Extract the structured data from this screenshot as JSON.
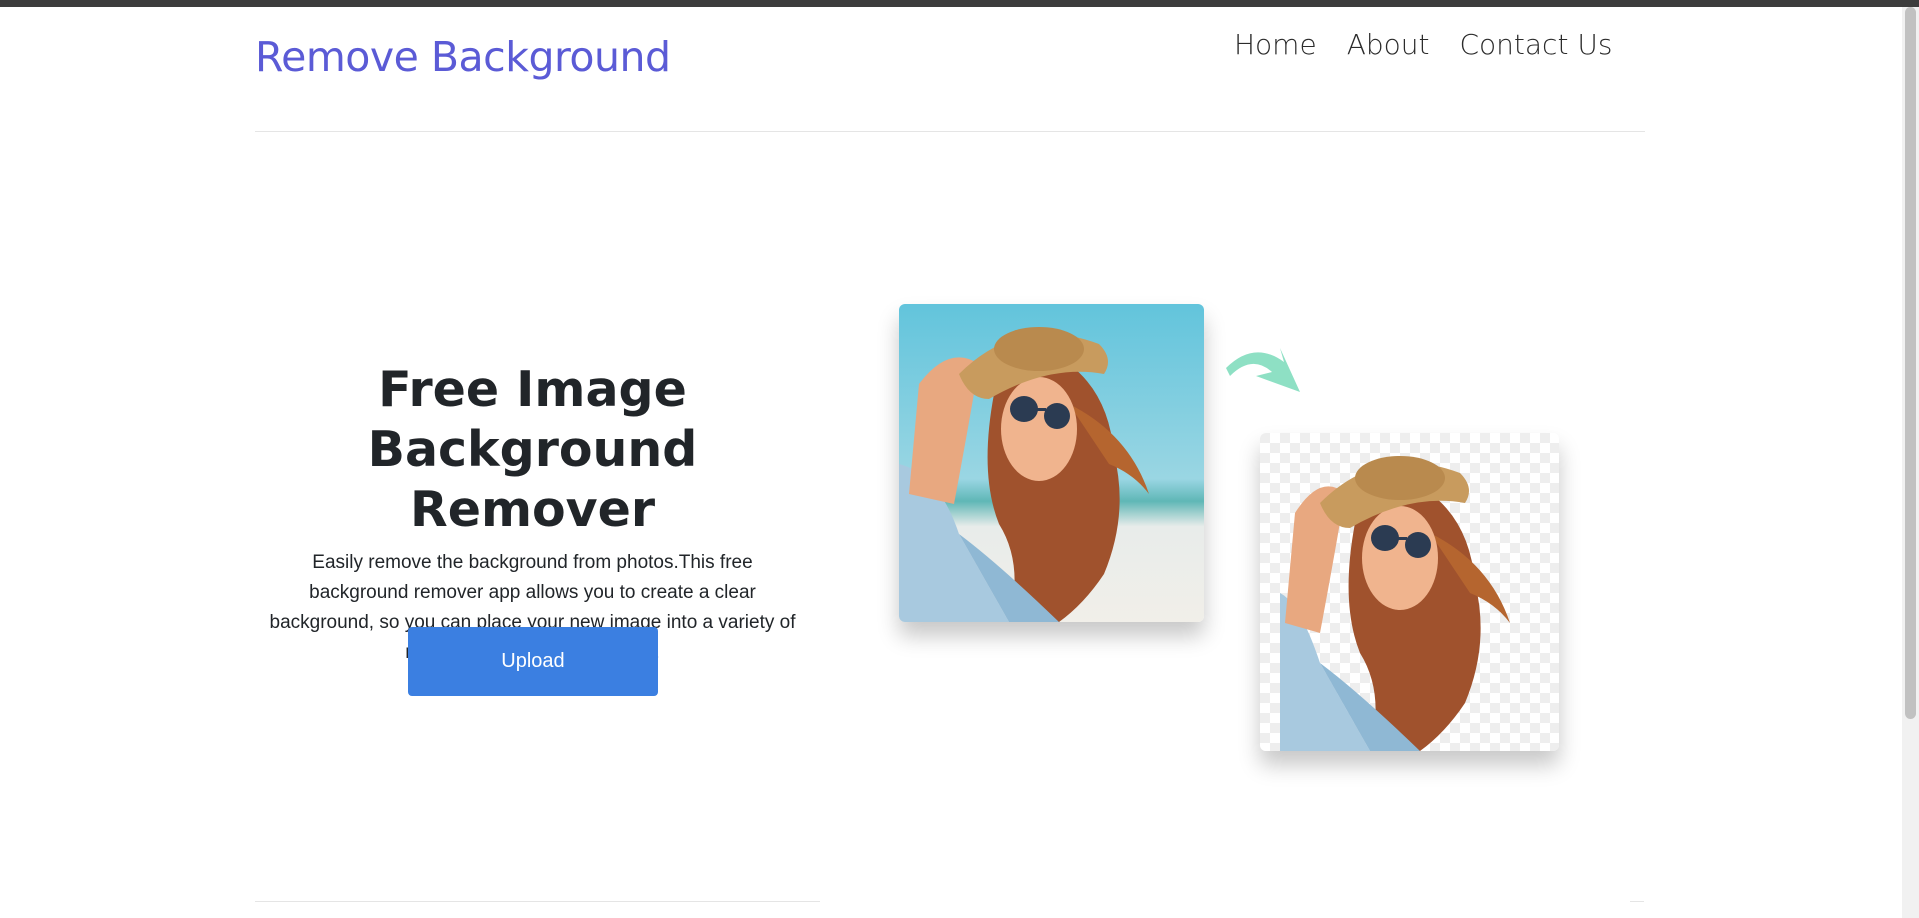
{
  "header": {
    "brand": "Remove Background",
    "nav": [
      "Home",
      "About",
      "Contact Us"
    ]
  },
  "hero": {
    "title_line1": "Free Image",
    "title_line2": "Background Remover",
    "description": "Easily remove the background from photos.This free background remover app allows you to create a clear background, so you can place your new image into a variety of new designs and destinations.",
    "upload_label": "Upload"
  },
  "icons": {
    "arrow": "curved-arrow-icon"
  },
  "colors": {
    "brand": "#5b5bd6",
    "button": "#3b7fe1",
    "arrow": "#8ee0c4"
  }
}
